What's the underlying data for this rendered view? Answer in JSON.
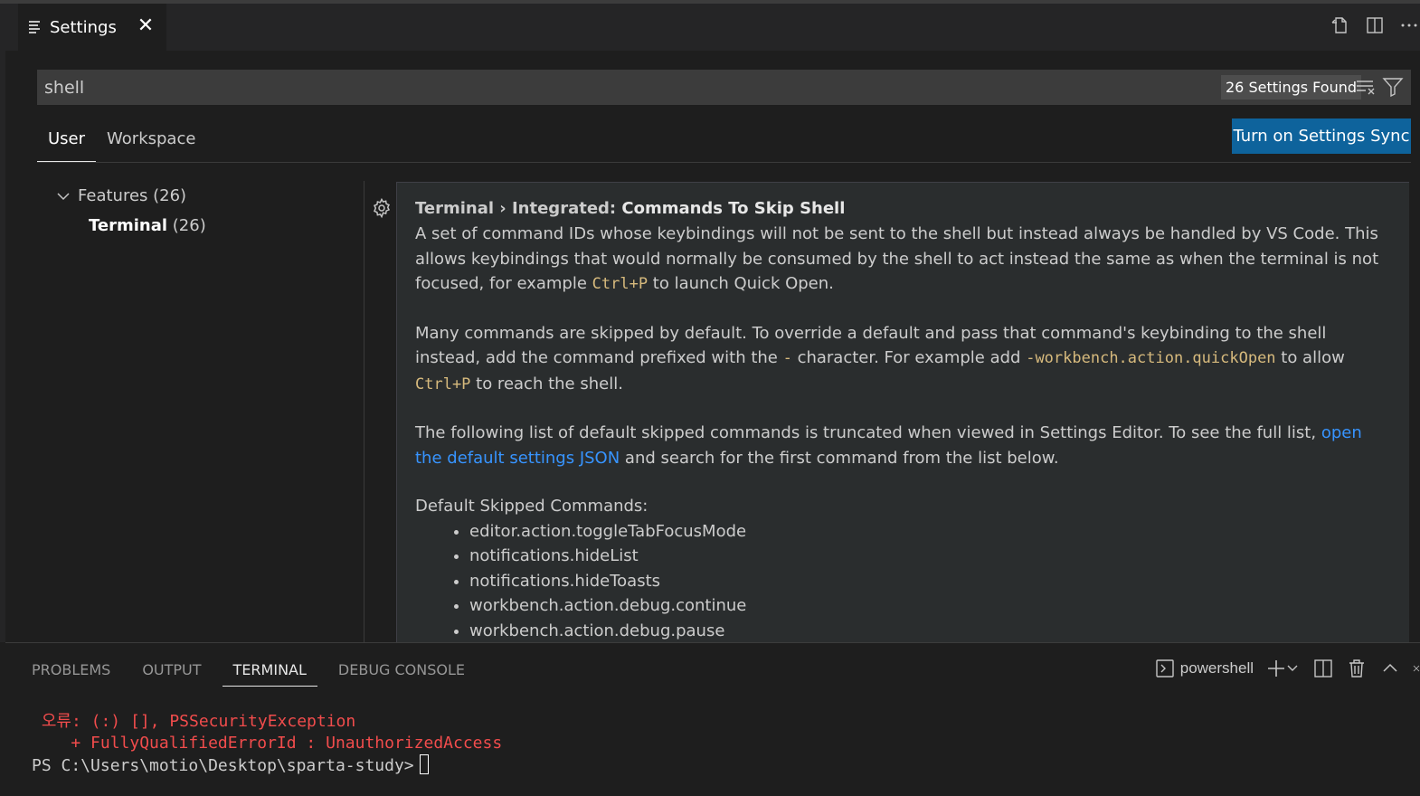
{
  "editor": {
    "tab_title": "Settings",
    "close_glyph": "✕"
  },
  "search": {
    "value": "shell",
    "found_label": "26 Settings Found"
  },
  "scope": {
    "user": "User",
    "workspace": "Workspace",
    "sync_button": "Turn on Settings Sync"
  },
  "toc": {
    "features": "Features (26)",
    "terminal_name": "Terminal",
    "terminal_count": "(26)"
  },
  "setting": {
    "category": "Terminal › Integrated: ",
    "name": "Commands To Skip Shell",
    "p1_a": "A set of command IDs whose keybindings will not be sent to the shell but instead always be handled by VS Code. This allows keybindings that would normally be consumed by the shell to act instead the same as when the terminal is not focused, for example ",
    "p1_code": "Ctrl+P",
    "p1_b": " to launch Quick Open.",
    "p2_a": "Many commands are skipped by default. To override a default and pass that command's keybinding to the shell instead, add the command prefixed with the ",
    "p2_code1": "-",
    "p2_b": " character. For example add ",
    "p2_code2": "-workbench.action.quickOpen",
    "p2_c": " to allow ",
    "p2_code3": "Ctrl+P",
    "p2_d": " to reach the shell.",
    "p3_a": "The following list of default skipped commands is truncated when viewed in Settings Editor. To see the full list, ",
    "p3_link": "open the default settings JSON",
    "p3_b": " and search for the first command from the list below.",
    "list_heading": "Default Skipped Commands:",
    "commands": [
      "editor.action.toggleTabFocusMode",
      "notifications.hideList",
      "notifications.hideToasts",
      "workbench.action.debug.continue",
      "workbench.action.debug.pause"
    ]
  },
  "panel": {
    "tabs": [
      "PROBLEMS",
      "OUTPUT",
      "TERMINAL",
      "DEBUG CONSOLE"
    ],
    "shell_name": "powershell"
  },
  "terminal": {
    "line1": " 오류: (:) [], PSSecurityException",
    "line2": "    + FullyQualifiedErrorId : UnauthorizedAccess",
    "prompt": "PS C:\\Users\\motio\\Desktop\\sparta-study>"
  },
  "colors": {
    "background": "#1e1e1e",
    "accent_button": "#0e639c",
    "link": "#3794ff",
    "code": "#d7ba7d",
    "error": "#f14c4c"
  }
}
